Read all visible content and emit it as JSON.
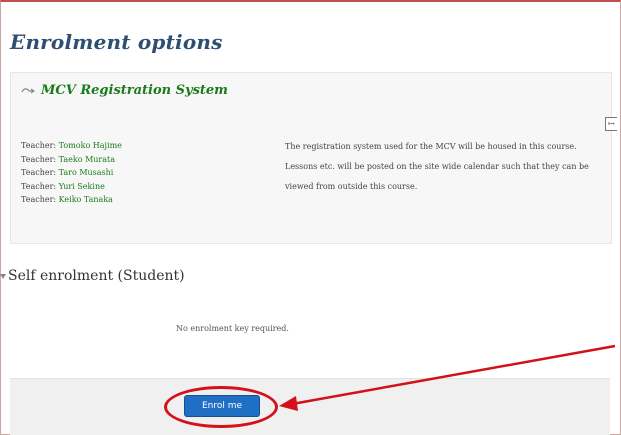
{
  "page": {
    "heading": "Enrolment options"
  },
  "course": {
    "icon": "course-link-icon",
    "title": "MCV Registration System",
    "enter_icon": "enter-course-icon",
    "teachers": [
      {
        "role": "Teacher: ",
        "name": "Tomoko Hajime"
      },
      {
        "role": "Teacher: ",
        "name": "Taeko Murata"
      },
      {
        "role": "Teacher: ",
        "name": "Taro Musashi"
      },
      {
        "role": "Teacher: ",
        "name": "Yuri Sekine"
      },
      {
        "role": "Teacher: ",
        "name": "Keiko Tanaka"
      }
    ],
    "summary": "The registration system used for the MCV will be housed in this course. Lessons etc. will be posted on the site wide calendar such that they can be viewed from outside this course."
  },
  "self_enrolment": {
    "title": "Self enrolment (Student)",
    "collapse_icon": "collapse-triangle-icon",
    "message": "No enrolment key required.",
    "button_label": "Enrol me"
  },
  "annotation": {
    "color": "#d4101a"
  },
  "colors": {
    "heading": "#2e4e72",
    "link": "#1b7a1b",
    "button": "#1f6fc5"
  }
}
